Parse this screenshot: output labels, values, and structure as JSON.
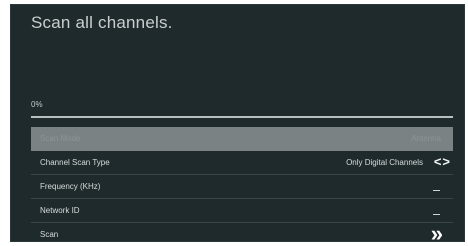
{
  "screen": {
    "title": "Scan all channels.",
    "progress": {
      "text": "0%",
      "value": 0
    }
  },
  "rows": [
    {
      "label": "Scan Mode",
      "value": "Antenna",
      "selected": true
    },
    {
      "label": "Channel Scan Type",
      "value": "Only Digital Channels",
      "control": "left-right-arrows-icon",
      "control_glyph": "<>"
    },
    {
      "label": "Frequency (KHz)",
      "value": ""
    },
    {
      "label": "Network ID",
      "value": ""
    },
    {
      "label": "Scan",
      "control": "double-chevron-right-icon",
      "control_glyph": "»"
    }
  ],
  "colors": {
    "background": "#1f2a2c",
    "selected_row": "#7a8284",
    "text": "#d6dcdc"
  }
}
